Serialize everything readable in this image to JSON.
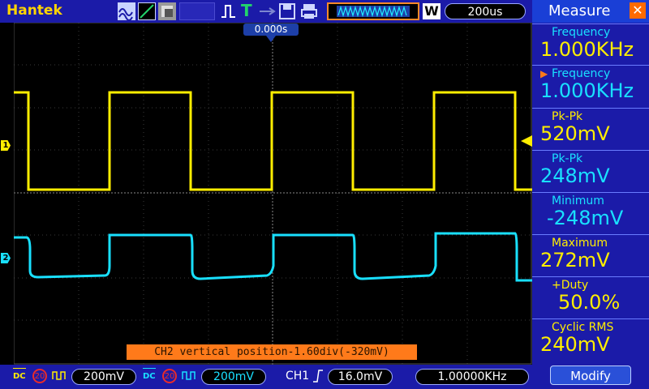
{
  "app": {
    "brand": "Hantek"
  },
  "toolbar": {
    "trigger_mode_label": "T",
    "timebase": "200us",
    "acq_mode_label": "W"
  },
  "screen": {
    "trigger_time_position": "0.000s",
    "ch1_marker": "1",
    "ch2_marker": "2",
    "status_message": "CH2 vertical position-1.60div(-320mV)"
  },
  "bottom": {
    "ch1": {
      "coupling": "DC",
      "bw_limit": "20",
      "volts_div": "200mV"
    },
    "ch2": {
      "coupling": "DC",
      "bw_limit": "20",
      "volts_div": "200mV"
    },
    "trigger": {
      "source": "CH1",
      "level": "16.0mV"
    },
    "freq_counter": "1.00000KHz"
  },
  "measure": {
    "title": "Measure",
    "items": [
      {
        "label": "Frequency",
        "value": "1.000KHz",
        "channel": "CH1"
      },
      {
        "label": "Frequency",
        "value": "1.000KHz",
        "channel": "CH2"
      },
      {
        "label": "Pk-Pk",
        "value": "520mV",
        "channel": "CH1"
      },
      {
        "label": "Pk-Pk",
        "value": "248mV",
        "channel": "CH2"
      },
      {
        "label": "Minimum",
        "value": "-248mV",
        "channel": "CH2"
      },
      {
        "label": "Maximum",
        "value": "272mV",
        "channel": "CH1"
      },
      {
        "label": "+Duty",
        "value": "50.0%",
        "channel": "CH1"
      },
      {
        "label": "Cyclic RMS",
        "value": "240mV",
        "channel": "CH1"
      }
    ],
    "modify_label": "Modify"
  },
  "colors": {
    "ch1": "#ffee00",
    "ch2": "#19e0ff",
    "bar": "#1b1ba8",
    "accent": "#ff7a1a"
  }
}
